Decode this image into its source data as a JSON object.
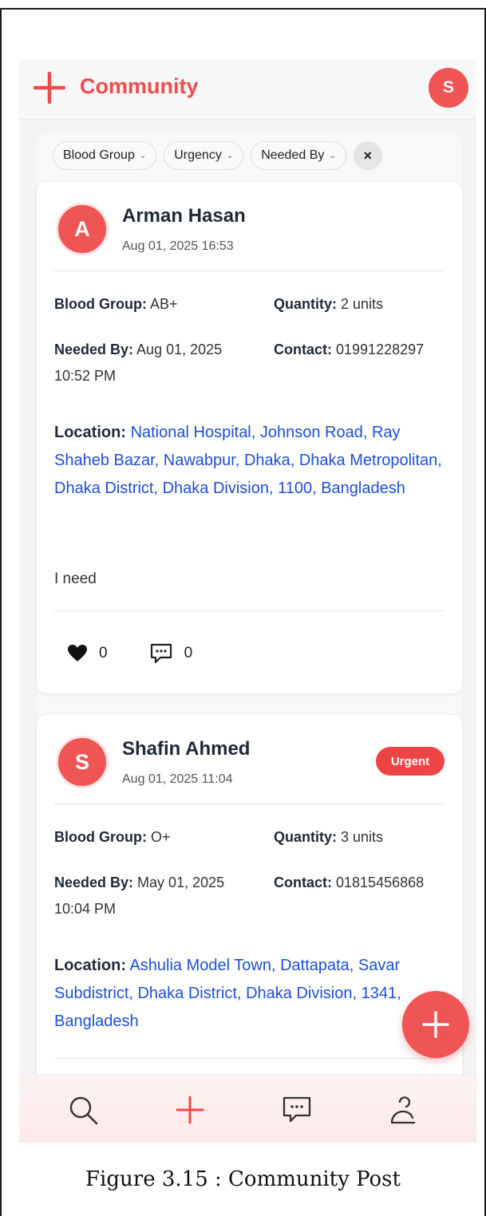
{
  "app": {
    "title": "Community",
    "user_initial": "S",
    "accent_color": "#ef5555"
  },
  "filters": {
    "chips": [
      "Blood Group",
      "Urgency",
      "Needed By"
    ],
    "clear_label": "×"
  },
  "posts": [
    {
      "author": "Arman Hasan",
      "initial": "A",
      "date": "Aug 01, 2025 16:53",
      "urgent": false,
      "blood_group_label": "Blood Group:",
      "blood_group": "AB+",
      "quantity_label": "Quantity:",
      "quantity": "2 units",
      "needed_by_label": "Needed By:",
      "needed_by_line1": "Aug 01, 2025",
      "needed_by_line2": "10:52 PM",
      "contact_label": "Contact:",
      "contact": "01991228297",
      "location_label": "Location:",
      "location": "National Hospital, Johnson Road, Ray Shaheb Bazar, Nawabpur, Dhaka, Dhaka Metropolitan, Dhaka District, Dhaka Division, 1100, Bangladesh",
      "description": "I need",
      "likes": "0",
      "comments": "0"
    },
    {
      "author": "Shafin Ahmed",
      "initial": "S",
      "date": "Aug 01, 2025 11:04",
      "urgent": true,
      "badge": "Urgent",
      "blood_group_label": "Blood Group:",
      "blood_group": "O+",
      "quantity_label": "Quantity:",
      "quantity": "3 units",
      "needed_by_label": "Needed By:",
      "needed_by_line1": "May 01, 2025",
      "needed_by_line2": "10:04 PM",
      "contact_label": "Contact:",
      "contact": "01815456868",
      "location_label": "Location:",
      "location": "Ashulia Model Town, Dattapata, Savar Subdistrict, Dhaka District, Dhaka Division, 1341, Bangladesh"
    }
  ],
  "bottom_nav": [
    "search-icon",
    "plus-icon",
    "chat-icon",
    "profile-icon"
  ],
  "caption": "Figure 3.15 : Community Post"
}
